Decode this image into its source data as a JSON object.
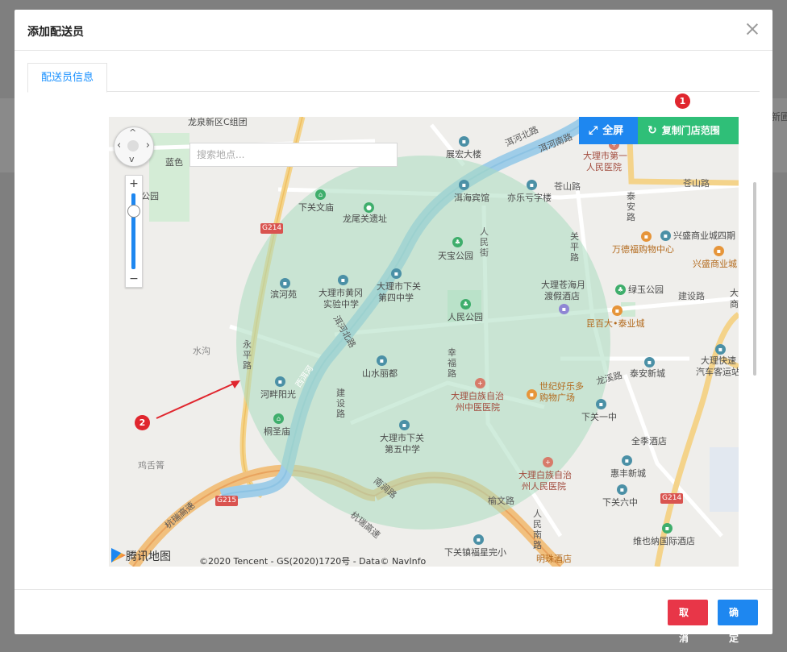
{
  "backdrop": {
    "partial_text": "新圃"
  },
  "modal": {
    "title": "添加配送员",
    "close_label": "关闭"
  },
  "tabs": [
    {
      "label": "配送员信息"
    }
  ],
  "map": {
    "search_placeholder": "搜索地点...",
    "fullscreen_label": "全屏",
    "copy_range_label": "复制门店范围",
    "zoom_plus": "+",
    "zoom_minus": "−",
    "logo_text": "腾讯地图",
    "copyright": "©2020 Tencent - GS(2020)1720号 - Data© NavInfo",
    "labels": {
      "l1": "龙泉新区C组团",
      "l2": "蓝色",
      "l3": "公园",
      "l4": "下关文庙",
      "l5": "龙尾关遗址",
      "l6": "展宏大楼",
      "l7": "洱河北路",
      "l8": "洱河南路",
      "l9": "大理市第一",
      "l10": "人民医院",
      "l11": "洱海宾馆",
      "l12": "亦乐亏字楼",
      "l13": "苍山路",
      "l14": "苍山路",
      "l15": "泰安路",
      "l16": "兴盛商业城四期",
      "l17": "万德福购物中心",
      "l18": "兴盛商业城",
      "l19": "关平路",
      "l20": "天宝公园",
      "l21": "人民街",
      "l22": "滨河苑",
      "l23": "大理市黄冈",
      "l24": "实验中学",
      "l25": "大理市下关",
      "l26": "第四中学",
      "l27": "大理苍海月",
      "l28": "渡假酒店",
      "l29": "绿玉公园",
      "l30": "建设路",
      "l31": "人民公园",
      "l32": "昆百大•泰业城",
      "l33": "水沟",
      "l34": "永平路",
      "l35": "洱河北路",
      "l36": "山水丽都",
      "l37": "幸福路",
      "l38": "大理快速",
      "l39": "汽车客运站",
      "l40": "大理白族自治",
      "l41": "州中医医院",
      "l42": "世纪好乐多",
      "l43": "购物广场",
      "l44": "龙溪路",
      "l45": "泰安新城",
      "l46": "河畔阳光",
      "l47": "建设路",
      "l48": "下关一中",
      "l49": "桐圣庙",
      "l50": "大理市下关",
      "l51": "第五中学",
      "l52": "全季酒店",
      "l53": "鸡舌箐",
      "l54": "大理白族自治",
      "l55": "州人民医院",
      "l56": "惠丰新城",
      "l57": "南涧路",
      "l58": "杭瑞高速",
      "l59": "杭瑞高速",
      "l60": "下关六中",
      "l61": "榆文路",
      "l62": "人民南路",
      "l63": "维也纳国际酒店",
      "l64": "下关镇福星完小",
      "l65": "明珠酒店",
      "l66": "G214",
      "l67": "G214",
      "l68": "G215",
      "l69": "西洱河",
      "l70": "大",
      "l71": "商"
    }
  },
  "annotations": {
    "badge1": "1",
    "badge2": "2"
  },
  "footer": {
    "cancel_label": "取消",
    "ok_label": "确定"
  },
  "colors": {
    "primary": "#1e87f0",
    "green": "#2fbf78",
    "danger": "#e83648",
    "range_fill": "#bfe6d0"
  }
}
